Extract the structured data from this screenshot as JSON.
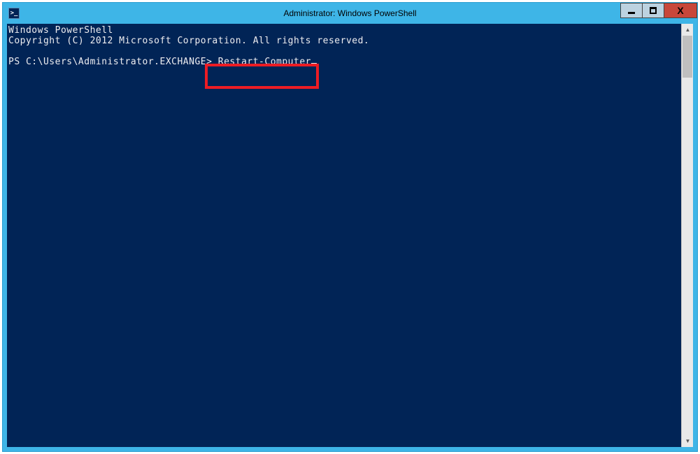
{
  "window": {
    "title": "Administrator: Windows PowerShell"
  },
  "console": {
    "line1": "Windows PowerShell",
    "line2": "Copyright (C) 2012 Microsoft Corporation. All rights reserved.",
    "prompt": "PS C:\\Users\\Administrator.EXCHANGE> ",
    "command": "Restart-Computer"
  }
}
